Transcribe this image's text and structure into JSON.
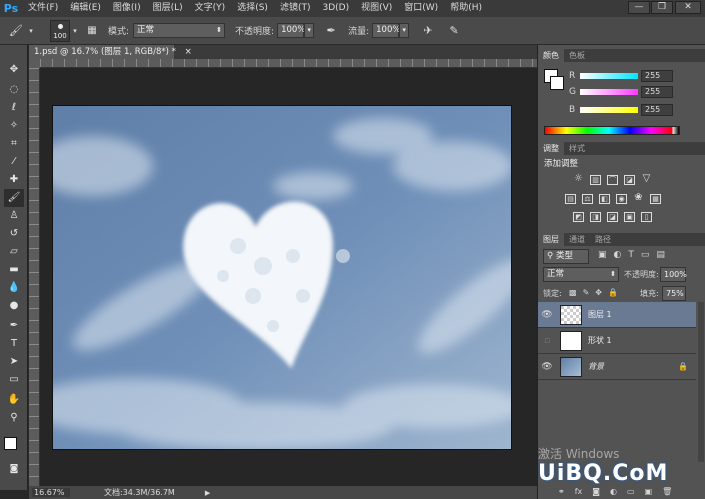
{
  "app": {
    "logo": "Ps"
  },
  "menu": [
    "文件(F)",
    "编辑(E)",
    "图像(I)",
    "图层(L)",
    "文字(Y)",
    "选择(S)",
    "滤镜(T)",
    "3D(D)",
    "视图(V)",
    "窗口(W)",
    "帮助(H)"
  ],
  "window_buttons": [
    "—",
    "❐",
    "✕"
  ],
  "options": {
    "brush_size": "100",
    "mode_label": "模式:",
    "mode_value": "正常",
    "opacity_label": "不透明度:",
    "opacity_value": "100%",
    "flow_label": "流量:",
    "flow_value": "100%"
  },
  "document": {
    "tab_title": "1.psd @ 16.7% (图层 1, RGB/8*) *",
    "close": "×",
    "zoom": "16.67%",
    "doc_size": "文档:34.3M/36.7M"
  },
  "color_panel": {
    "tabs": [
      "颜色",
      "色板"
    ],
    "channels": [
      {
        "label": "R",
        "value": "255",
        "color": "#00e5ff"
      },
      {
        "label": "G",
        "value": "255",
        "color": "#ff3cff"
      },
      {
        "label": "B",
        "value": "255",
        "color": "#ffff00"
      }
    ]
  },
  "adjust_panel": {
    "tabs": [
      "调整",
      "样式"
    ],
    "title": "添加调整"
  },
  "layers_panel": {
    "tabs": [
      "图层",
      "通道",
      "路径"
    ],
    "filter_label": "类型",
    "blend_mode": "正常",
    "opacity_label": "不透明度:",
    "opacity_value": "100%",
    "lock_label": "锁定:",
    "fill_label": "填充:",
    "fill_value": "75%",
    "layers": [
      {
        "name": "图层 1",
        "selected": true
      },
      {
        "name": "形状 1",
        "selected": false
      },
      {
        "name": "背景",
        "selected": false
      }
    ]
  },
  "watermark": {
    "activate": "激活 Windows",
    "site": "UiBQ.CoM"
  }
}
